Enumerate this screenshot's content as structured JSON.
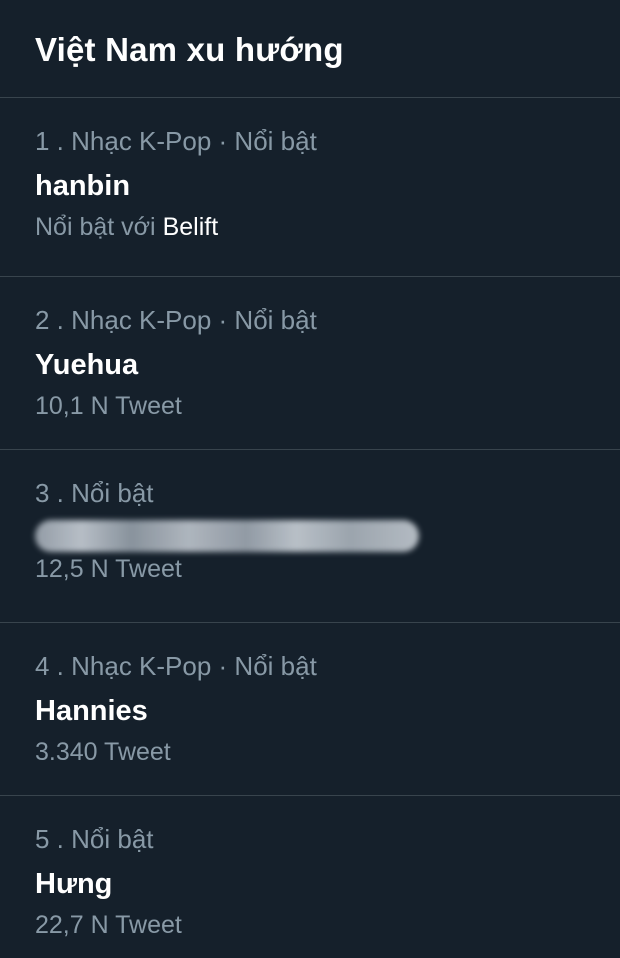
{
  "header": {
    "title": "Việt Nam xu hướng"
  },
  "trends": [
    {
      "context": "1 . Nhạc K-Pop · Nổi bật",
      "name": "hanbin",
      "meta_prefix": "Nổi bật với ",
      "meta_highlight": "Belift"
    },
    {
      "context": "2 . Nhạc K-Pop · Nổi bật",
      "name": "Yuehua",
      "meta": "10,1 N Tweet"
    },
    {
      "context": "3 . Nổi bật",
      "name_blurred": true,
      "meta": "12,5 N Tweet"
    },
    {
      "context": "4 . Nhạc K-Pop · Nổi bật",
      "name": "Hannies",
      "meta": "3.340 Tweet"
    },
    {
      "context": "5 . Nổi bật",
      "name": "Hưng",
      "meta": "22,7 N Tweet"
    }
  ]
}
